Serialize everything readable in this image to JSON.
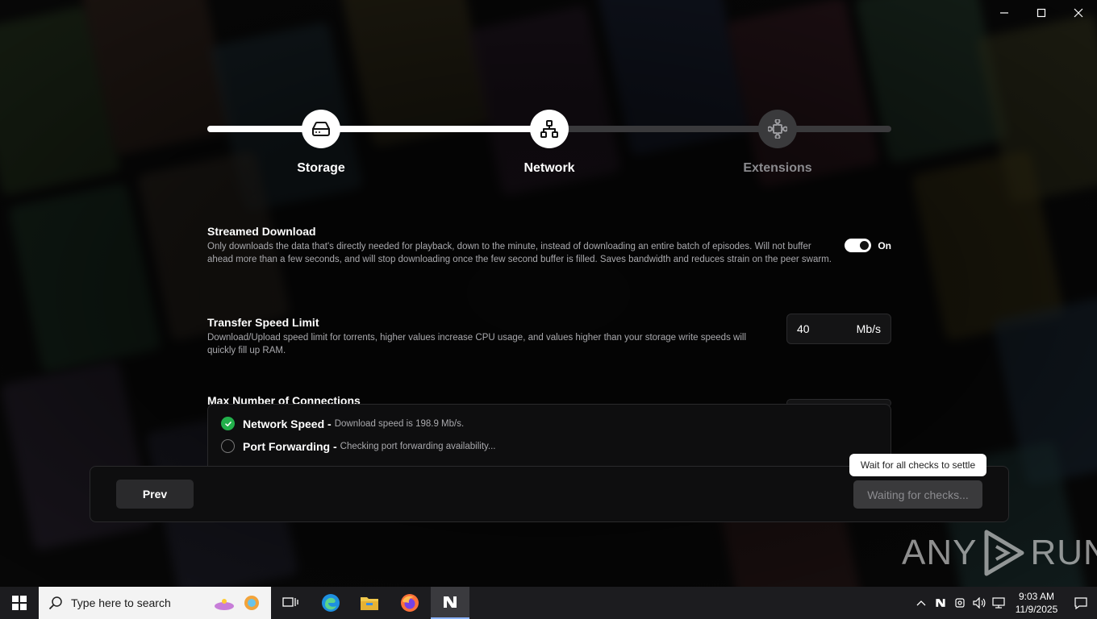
{
  "window": {
    "controls": [
      "minimize-icon",
      "maximize-icon",
      "close-icon"
    ]
  },
  "stepper": {
    "progress": 0.5,
    "steps": [
      {
        "label": "Storage",
        "icon": "hard-drive-icon",
        "state": "complete"
      },
      {
        "label": "Network",
        "icon": "network-icon",
        "state": "active"
      },
      {
        "label": "Extensions",
        "icon": "puzzle-icon",
        "state": "inactive"
      }
    ]
  },
  "settings": {
    "streamed": {
      "title": "Streamed Download",
      "description": "Only downloads the data that's directly needed for playback, down to the minute, instead of downloading an entire batch of episodes. Will not buffer ahead more than a few seconds, and will stop downloading once the few second buffer is filled. Saves bandwidth and reduces strain on the peer swarm.",
      "toggle_label": "On",
      "enabled": true
    },
    "speed": {
      "title": "Transfer Speed Limit",
      "description": "Download/Upload speed limit for torrents, higher values increase CPU usage, and values higher than your storage write speeds will quickly fill up RAM.",
      "value": "40",
      "unit": "Mb/s"
    },
    "connections": {
      "title": "Max Number of Connections"
    }
  },
  "checks": [
    {
      "name": "Network Speed -",
      "detail": "Download speed is 198.9 Mb/s.",
      "status": "ok"
    },
    {
      "name": "Port Forwarding -",
      "detail": "Checking port forwarding availability...",
      "status": "pending"
    }
  ],
  "footer": {
    "prev_label": "Prev",
    "next_label": "Waiting for checks...",
    "tooltip": "Wait for all checks to settle"
  },
  "watermark": {
    "left": "ANY",
    "right": "RUN"
  },
  "taskbar": {
    "search_placeholder": "Type here to search",
    "time": "9:03 AM",
    "date": "11/9/2025",
    "colors": {
      "accent": "#8cb4ff",
      "edge": "#1e90e0",
      "folder": "#f2c94c",
      "firefox": "#ff7139"
    }
  }
}
